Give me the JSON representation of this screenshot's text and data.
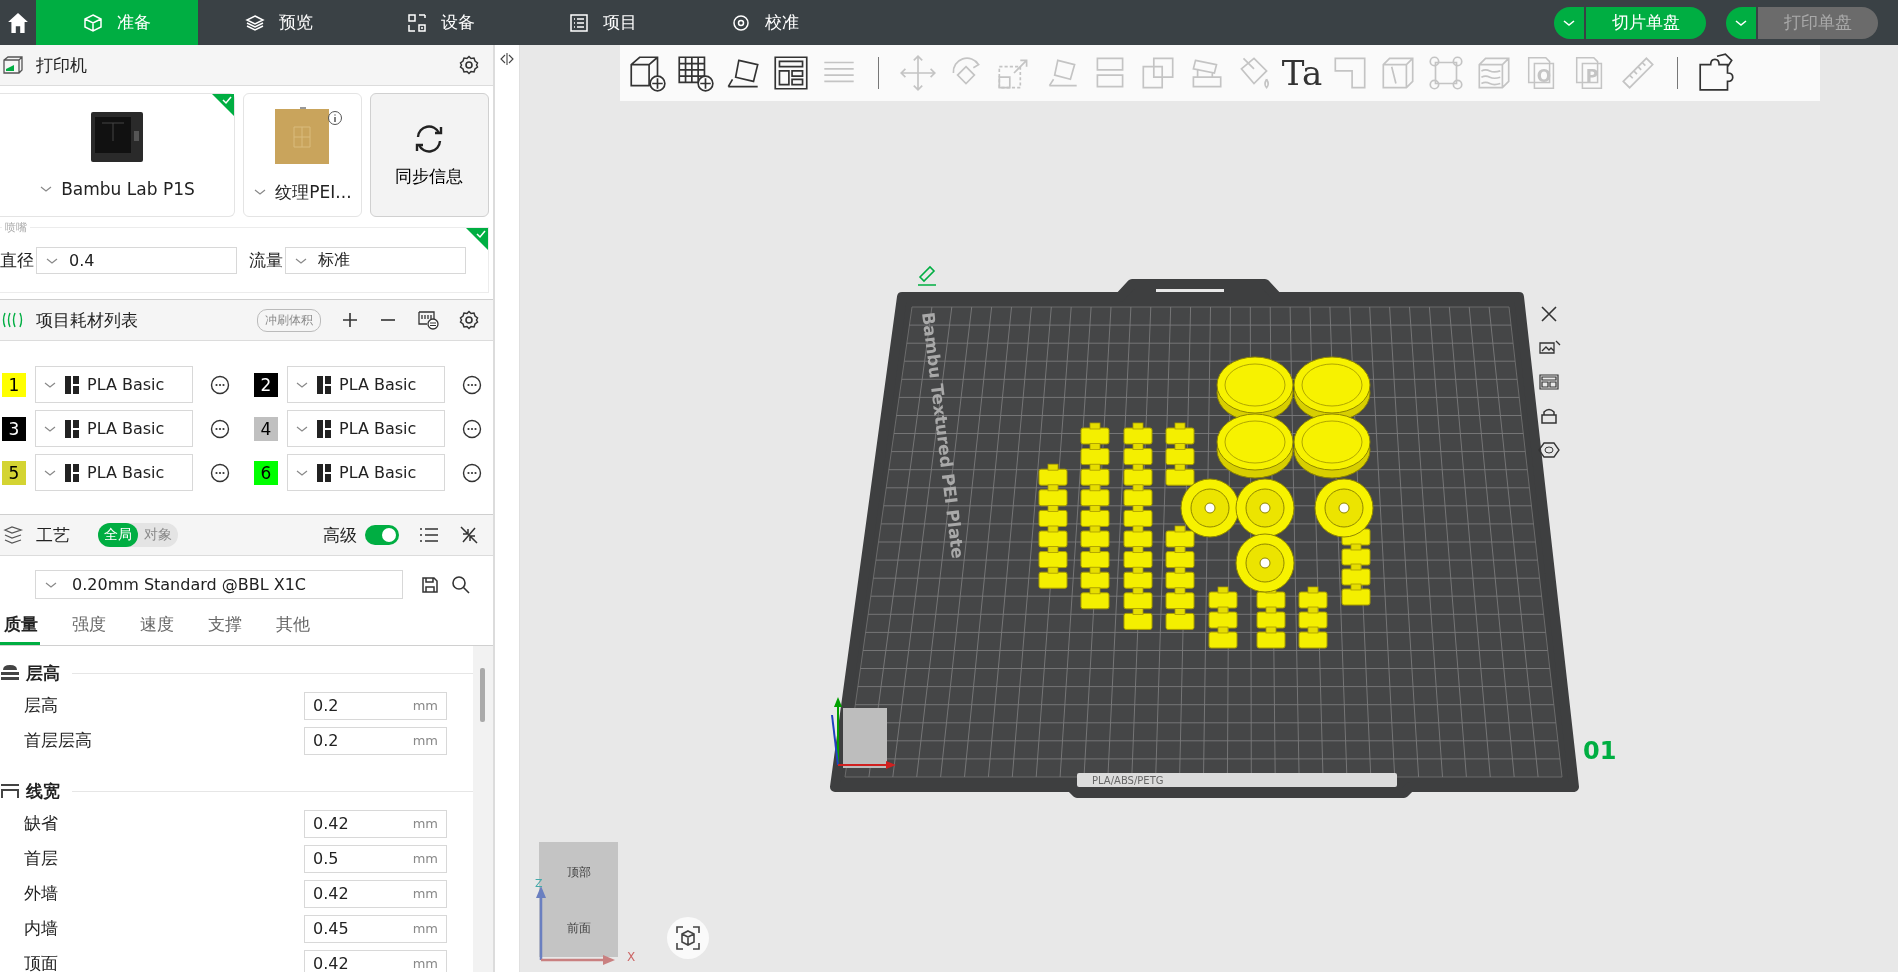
{
  "top_nav": {
    "tabs": [
      {
        "kind": "cube",
        "label": "准备",
        "selected": true
      },
      {
        "kind": "layers",
        "label": "预览",
        "selected": false
      },
      {
        "kind": "device",
        "label": "设备",
        "selected": false
      },
      {
        "kind": "list",
        "label": "项目",
        "selected": false
      },
      {
        "kind": "gear",
        "label": "校准",
        "selected": false
      }
    ],
    "actions": [
      {
        "label": "切片单盘",
        "disabled": false
      },
      {
        "label": "打印单盘",
        "disabled": true
      }
    ]
  },
  "printer": {
    "title": "打印机",
    "model": "Bambu Lab P1S",
    "plate": "纹理PEI...",
    "sync": "同步信息",
    "nozzle_legend": "喷嘴",
    "diameter_label": "直径",
    "diameter": "0.4",
    "flow_label": "流量",
    "flow": "标准"
  },
  "filaments": {
    "title": "项目耗材列表",
    "flush_button": "冲刷体积",
    "items": [
      {
        "index": "1",
        "color": "#ffff00",
        "name": "PLA Basic"
      },
      {
        "index": "2",
        "color": "#000000",
        "name": "PLA Basic"
      },
      {
        "index": "3",
        "color": "#000000",
        "name": "PLA Basic"
      },
      {
        "index": "4",
        "color": "#c0c0c0",
        "name": "PLA Basic"
      },
      {
        "index": "5",
        "color": "#d4d432",
        "name": "PLA Basic"
      },
      {
        "index": "6",
        "color": "#00ff00",
        "name": "PLA Basic"
      }
    ]
  },
  "process": {
    "title": "工艺",
    "scope": [
      {
        "label": "全局",
        "selected": true
      },
      {
        "label": "对象",
        "selected": false
      }
    ],
    "advanced_label": "高级",
    "advanced": true,
    "preset": "0.20mm Standard @BBL X1C",
    "tabs": [
      {
        "label": "质量",
        "selected": true
      },
      {
        "label": "强度",
        "selected": false
      },
      {
        "label": "速度",
        "selected": false
      },
      {
        "label": "支撑",
        "selected": false
      },
      {
        "label": "其他",
        "selected": false
      }
    ],
    "groups": [
      {
        "kind": "layers",
        "title": "层高",
        "settings": [
          {
            "label": "层高",
            "value": "0.2",
            "unit": "mm"
          },
          {
            "label": "首层层高",
            "value": "0.2",
            "unit": "mm"
          }
        ]
      },
      {
        "kind": "width",
        "title": "线宽",
        "settings": [
          {
            "label": "缺省",
            "value": "0.42",
            "unit": "mm"
          },
          {
            "label": "首层",
            "value": "0.5",
            "unit": "mm"
          },
          {
            "label": "外墙",
            "value": "0.42",
            "unit": "mm"
          },
          {
            "label": "内墙",
            "value": "0.45",
            "unit": "mm"
          },
          {
            "label": "顶面",
            "value": "0.42",
            "unit": "mm"
          }
        ]
      }
    ]
  },
  "toolbar": [
    {
      "kind": "cube-plus",
      "disabled": false
    },
    {
      "kind": "grid-plus",
      "disabled": false
    },
    {
      "kind": "auto-orient",
      "disabled": false
    },
    {
      "kind": "arrange",
      "disabled": false
    },
    {
      "kind": "layers-list",
      "disabled": true
    },
    {
      "kind": "separator"
    },
    {
      "kind": "move",
      "disabled": true
    },
    {
      "kind": "rotate",
      "disabled": true
    },
    {
      "kind": "scale",
      "disabled": true
    },
    {
      "kind": "lay-flat",
      "disabled": true
    },
    {
      "kind": "cut",
      "disabled": true
    },
    {
      "kind": "boolean",
      "disabled": true
    },
    {
      "kind": "support",
      "disabled": true
    },
    {
      "kind": "paint",
      "disabled": true
    },
    {
      "kind": "text",
      "label": "Ta",
      "disabled": false
    },
    {
      "kind": "seam",
      "disabled": true
    },
    {
      "kind": "cube-edge",
      "disabled": true
    },
    {
      "kind": "fix",
      "disabled": true
    },
    {
      "kind": "wave-cube",
      "disabled": true
    },
    {
      "kind": "plate-letter",
      "label": "O",
      "disabled": true
    },
    {
      "kind": "plate-letter",
      "label": "P",
      "disabled": true
    },
    {
      "kind": "ruler",
      "disabled": true
    },
    {
      "kind": "separator"
    },
    {
      "kind": "puzzle",
      "disabled": false
    }
  ],
  "viewport": {
    "plate_label": "Bambu Textured PEI Plate",
    "plate_material": "PLA/ABS/PETG",
    "plate_number": "01",
    "nav_cube": {
      "top": "顶部",
      "front": "前面"
    },
    "axes": {
      "z": "Z",
      "x": "X"
    }
  }
}
